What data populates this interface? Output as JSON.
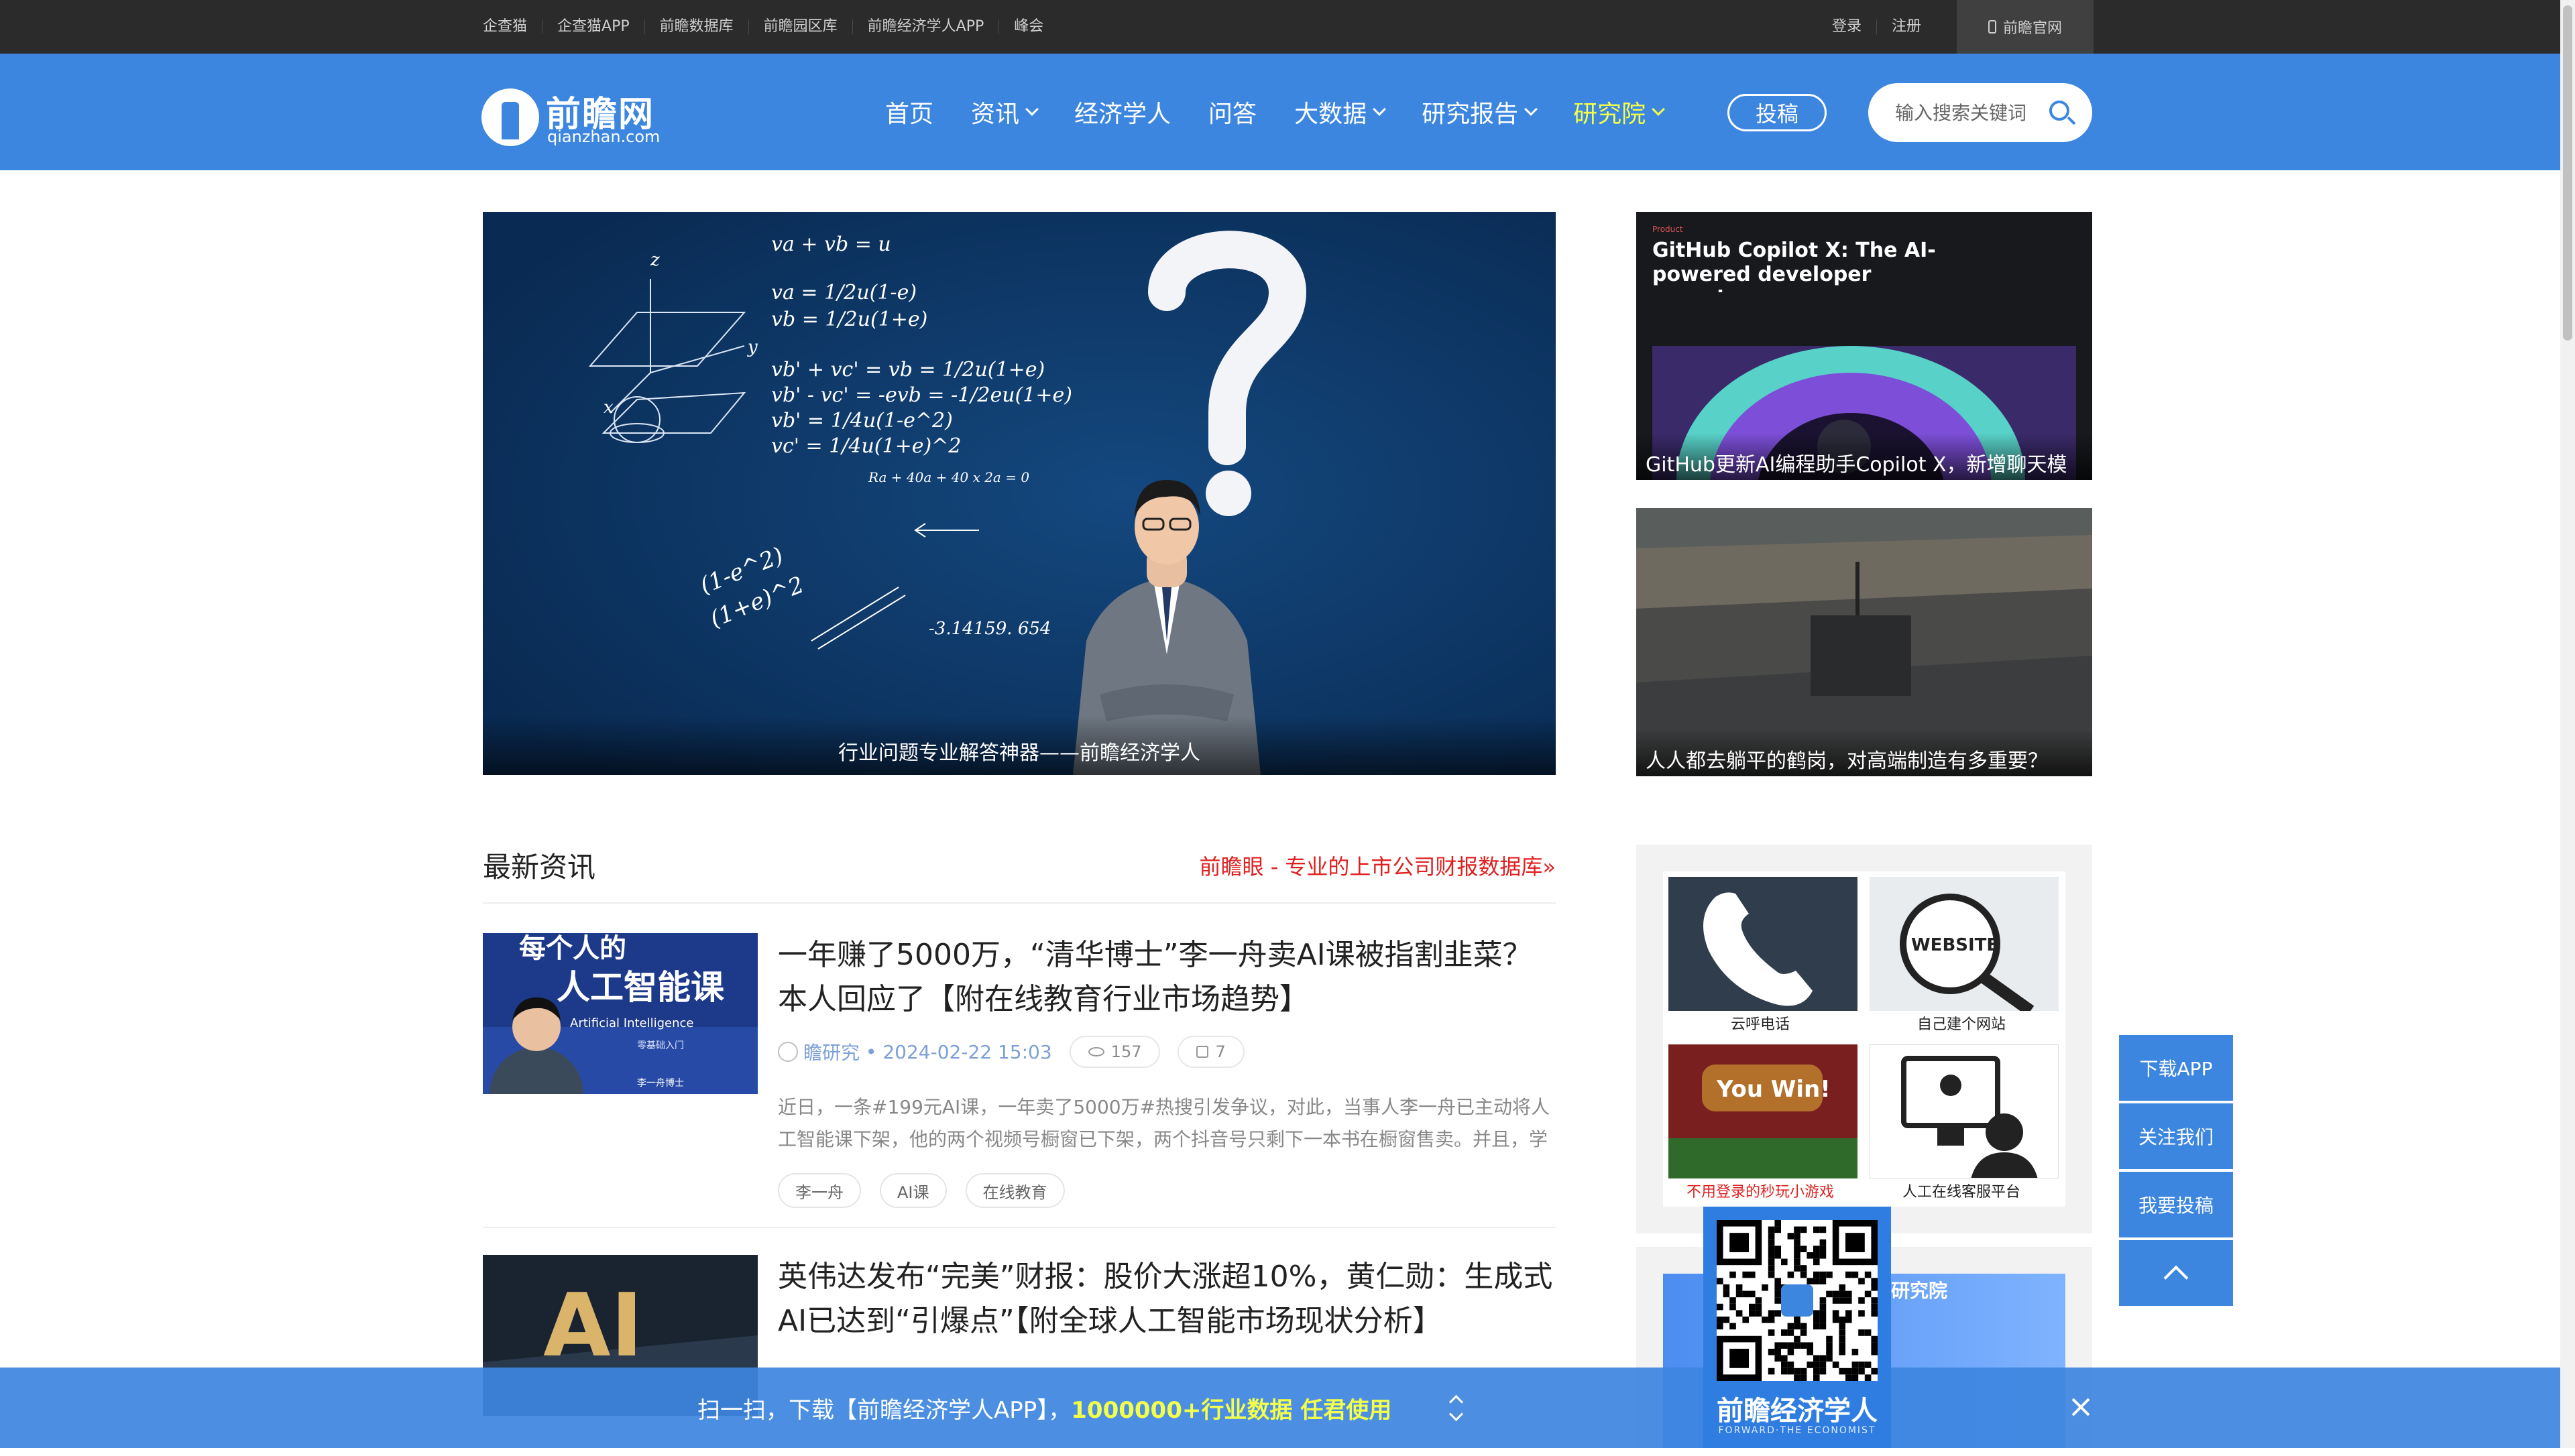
{
  "topbar": {
    "links": [
      "企查猫",
      "企查猫APP",
      "前瞻数据库",
      "前瞻园区库",
      "前瞻经济学人APP",
      "峰会"
    ],
    "login": "登录",
    "register": "注册",
    "official_site": "前瞻官网"
  },
  "header": {
    "logo_cn": "前瞻网",
    "logo_en": "qianzhan.com",
    "nav": [
      "首页",
      "资讯",
      "经济学人",
      "问答",
      "大数据",
      "研究报告",
      "研究院"
    ],
    "submit_label": "投稿",
    "search_placeholder": "输入搜索关键词"
  },
  "hero": {
    "caption": "行业问题专业解答神器——前瞻经济学人",
    "formulas": [
      "va + vb = u",
      "va = 1/2u(1-e)",
      "vb = 1/2u(1+e)",
      "vb' + vc' = vb = 1/2u(1+e)",
      "vb' - vc' = -evb = -1/2eu(1+e)",
      "vb' = 1/4u(1-e^2)",
      "vc' = 1/4u(1+e)^2",
      "Ra + 40a + 40 x 2a = 0",
      "(1-e^2)",
      "(1+e)^2",
      "-3.14159. 654"
    ],
    "axis_labels": [
      "z",
      "y",
      "x"
    ]
  },
  "side_cards": [
    {
      "caption": "GitHub更新AI编程助手Copilot X，新增聊天模",
      "tag": "Product",
      "headline": "GitHub Copilot X: The AI-powered developer experience"
    },
    {
      "caption": "人人都去躺平的鹤岗，对高端制造有多重要？"
    }
  ],
  "news": {
    "section_title": "最新资讯",
    "promo_link": "前瞻眼 - 专业的上市公司财报数据库»",
    "articles": [
      {
        "title": "一年赚了5000万，“清华博士”李一舟卖AI课被指割韭菜？本人回应了【附在线教育行业市场趋势】",
        "author": "瞻研究",
        "date": "2024-02-22 15:03",
        "views": "157",
        "likes": "7",
        "summary": "近日，一条#199元AI课，一年卖了5000万#热搜引发争议，对此，当事人李一舟已主动将人工智能课下架，他的两个视频号橱窗已下架，两个抖音号只剩下一本书在橱窗售卖。并且，学员",
        "tags": [
          "李一舟",
          "AI课",
          "在线教育"
        ],
        "thumb_text": [
          "每个人的",
          "人工智能课",
          "Artificial Intelligence",
          "零基础入门",
          "李一舟博士"
        ]
      },
      {
        "title": "英伟达发布“完美”财报：股价大涨超10%，黄仁勋：生成式AI已达到“引爆点”【附全球人工智能市场现状分析】",
        "thumb_text": [
          "AI"
        ]
      }
    ]
  },
  "ads": {
    "cells": [
      {
        "label": "云呼电话",
        "red": false
      },
      {
        "label": "自己建个网站",
        "red": false,
        "img_text": "WEBSITE"
      },
      {
        "label": "不用登录的秒玩小游戏",
        "red": true,
        "img_text": "You Win!"
      },
      {
        "label": "人工在线客服平台",
        "red": false
      }
    ],
    "banner2_text": "研究院"
  },
  "floatbar": [
    "下载APP",
    "关注我们",
    "我要投稿"
  ],
  "qr": {
    "name": "前瞻经济学人",
    "sub": "FORWARD·THE ECONOMIST"
  },
  "appbar": {
    "msg_prefix": "扫一扫，下载【前瞻经济学人APP】，",
    "msg_highlight": "1000000+行业数据 任君使用"
  },
  "colors": {
    "brand_blue": "#3d86e0",
    "highlight_yellow": "#f3ff4a",
    "promo_red": "#e02020",
    "topbar_bg": "#2b2b2b"
  }
}
